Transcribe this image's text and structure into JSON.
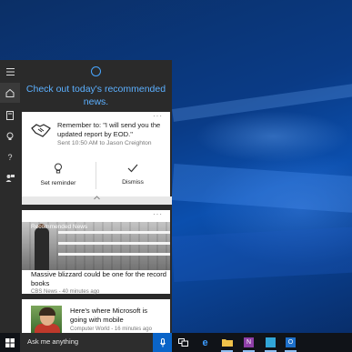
{
  "cortana": {
    "headline": "Check out today's recommended news."
  },
  "reminder_card": {
    "more": "···",
    "title": "Remember to: \"I will send you the updated report by EOD.\"",
    "subtitle": "Sent 10:50 AM to Jason Creighton",
    "set_reminder": "Set reminder",
    "dismiss": "Dismiss"
  },
  "news_card": {
    "more": "···",
    "label": "Recommended News",
    "title": "Massive blizzard could be one for the record books",
    "meta": "CBS News - 40 minutes ago"
  },
  "news_card_2": {
    "title": "Here's where Microsoft is going with mobile",
    "meta": "Computer World - 16 minutes ago"
  },
  "taskbar": {
    "search_placeholder": "Ask me anything",
    "icons": [
      "task-view-icon",
      "edge-icon",
      "file-explorer-icon",
      "onenote-icon",
      "store-icon",
      "outlook-icon"
    ]
  },
  "colors": {
    "accent": "#0a64c8",
    "cortana_blue": "#5cb0ff",
    "panel_bg": "#2a2a2a"
  }
}
